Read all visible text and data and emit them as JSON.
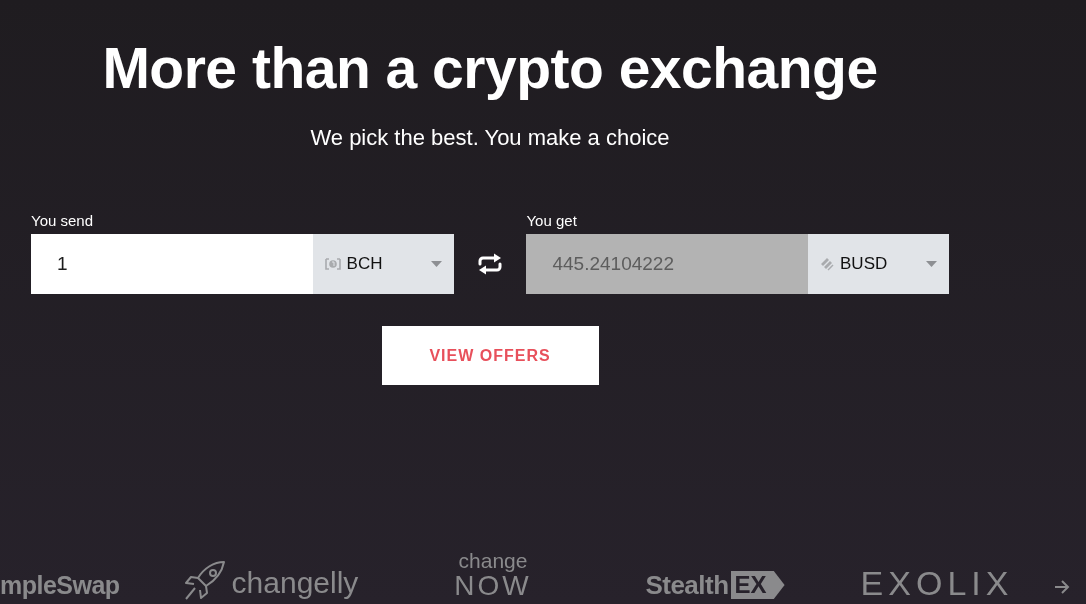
{
  "title": "More than a crypto exchange",
  "subtitle": "We pick the best. You make a choice",
  "exchange": [
    {
      "label": "You send",
      "value": "1",
      "currency": "BCH",
      "readonly": false
    },
    {
      "label": "You get",
      "value": "445.24104222",
      "currency": "BUSD",
      "readonly": true
    }
  ],
  "action": {
    "label": "VIEW OFFERS"
  },
  "partners": [
    {
      "kind": "wordmark",
      "name": "mpleSwap"
    },
    {
      "kind": "rocket",
      "name": "changelly"
    },
    {
      "kind": "stacked",
      "name": "change",
      "sub": "NOW"
    },
    {
      "kind": "tagged",
      "name": "Stealth",
      "tag": "EX"
    },
    {
      "kind": "spaced",
      "name": "EXOLIX"
    }
  ]
}
